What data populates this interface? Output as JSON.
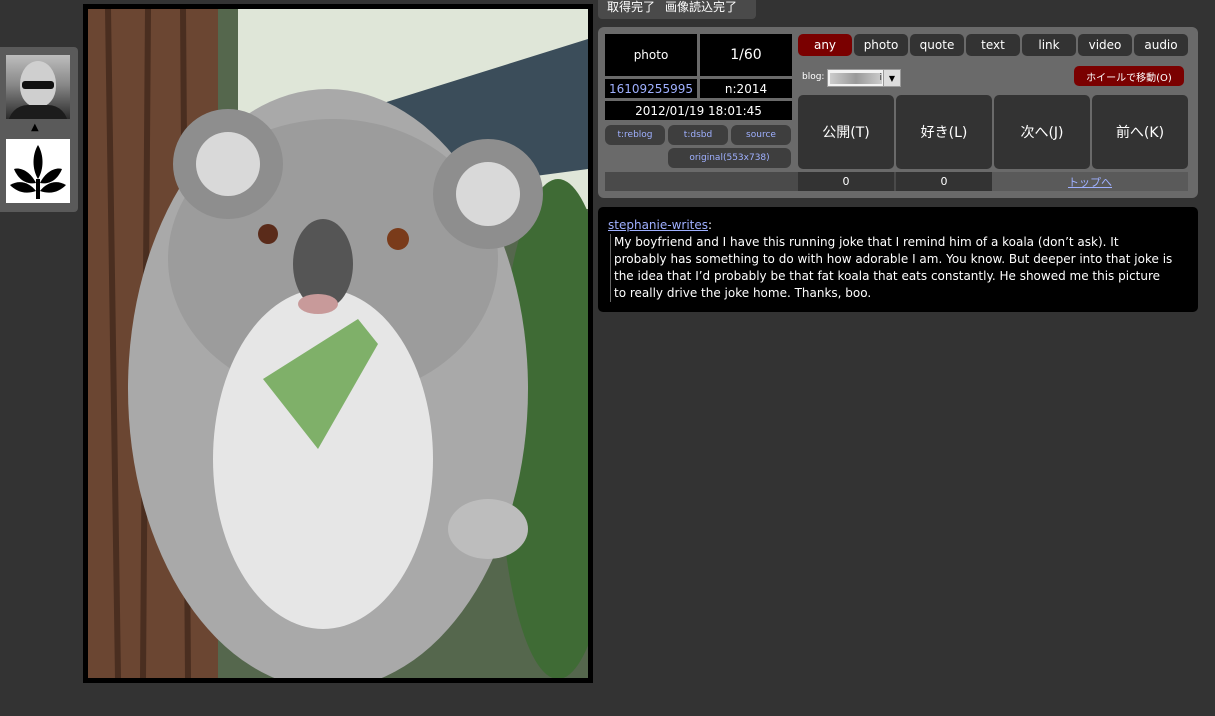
{
  "status": {
    "fetch_complete": "取得完了",
    "image_loaded": "画像読込完了"
  },
  "post": {
    "type": "photo",
    "position": "1/60",
    "id": "16109255995",
    "notes": "n:2014",
    "datetime": "2012/01/19 18:01:45",
    "buttons": {
      "reblog": "t:reblog",
      "dsbd": "t:dsbd",
      "source": "source",
      "original": "original(553x738)"
    }
  },
  "filters": [
    "any",
    "photo",
    "quote",
    "text",
    "link",
    "video",
    "audio"
  ],
  "active_filter": "any",
  "blog": {
    "label": "blog:",
    "selected": "i"
  },
  "wheel_button": "ホイールで移動(O)",
  "actions": {
    "publish": "公開(T)",
    "like": "好き(L)",
    "next": "次へ(J)",
    "prev": "前へ(K)"
  },
  "counts": {
    "publish_count": "0",
    "like_count": "0"
  },
  "top_link": "トップへ",
  "caption": {
    "author": "stephanie-writes",
    "colon": ":",
    "text": "My boyfriend and I have this running joke that I remind him of a koala (don’t ask). It probably has something to do with how adorable I am. You know. But deeper into that joke is the idea that I’d probably be that fat koala that eats constantly. He showed me this picture to really drive the joke home. Thanks, boo."
  },
  "colors": {
    "accent_red": "#7a0000",
    "link_blue": "#9fb0ff",
    "background": "#333333"
  }
}
